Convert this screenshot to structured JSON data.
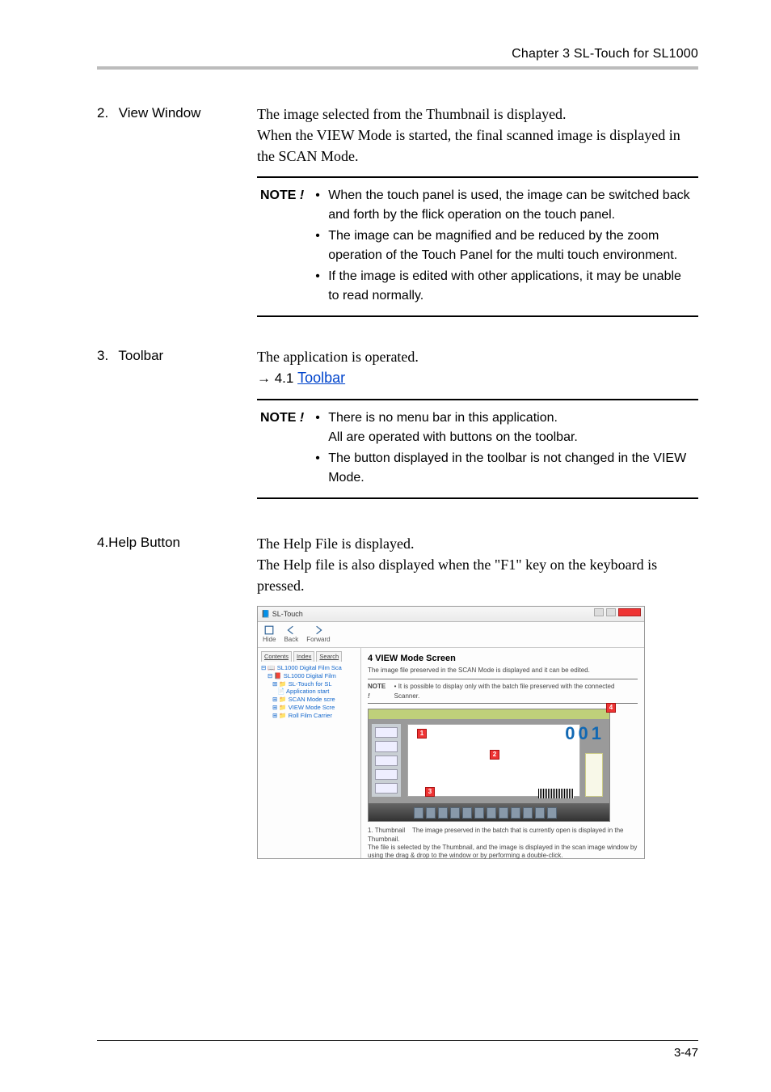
{
  "header": {
    "runhead": "Chapter 3 SL-Touch for SL1000"
  },
  "sections": {
    "s2": {
      "num": "2.",
      "label": "View Window",
      "body": "The image selected from the Thumbnail is displayed.\nWhen the VIEW Mode is started, the final scanned image is displayed in the SCAN Mode.",
      "note_label": "NOTE !",
      "notes": [
        "When the touch panel is used, the image can be switched back and forth by the flick operation on the touch panel.",
        "The image can be magnified and be reduced by the zoom operation of the Touch Panel for the multi touch environment.",
        "If the image is edited with other applications, it may be unable to read normally."
      ]
    },
    "s3": {
      "num": "3.",
      "label": "Toolbar",
      "body": "The application is operated.",
      "link_prefix": "→ 4.1 ",
      "link": "Toolbar",
      "note_label": "NOTE !",
      "notes": [
        "There is no menu bar in this application.\nAll are operated with buttons on the toolbar.",
        "The button displayed in the toolbar is not changed in the VIEW Mode."
      ]
    },
    "s4": {
      "label": "4.Help Button",
      "body": "The Help File is displayed.\nThe Help file is also displayed when the \"F1\" key on the keyboard is pressed."
    }
  },
  "helpwin": {
    "title": "SL-Touch",
    "toolbar": {
      "hide": "Hide",
      "back": "Back",
      "forward": "Forward"
    },
    "tabs": {
      "contents": "Contents",
      "index": "Index",
      "search": "Search"
    },
    "tree": {
      "root": "SL1000 Digital Film Sca",
      "n1": "SL1000 Digital Film",
      "n2": "SL-Touch for SL",
      "n3": "Application start",
      "n4": "SCAN Mode scre",
      "n5": "VIEW Mode Scre",
      "n6": "Roll Film Carrier"
    },
    "content": {
      "h": "4 VIEW Mode Screen",
      "sub": "The image file preserved in the SCAN Mode is displayed and it can be edited.",
      "note_label": "NOTE !",
      "note_text": "It is possible to display only with the batch file preserved with the connected Scanner.",
      "bignum": "001",
      "thumb_label": "1. Thumbnail",
      "thumb_text": "The image preserved in the batch that is currently open is displayed in the Thumbnail.\nThe file is selected by the Thumbnail, and the image is displayed in the scan image window by using the drag & drop to the window or by performing a double-click."
    }
  },
  "footer": {
    "pgnum": "3-47"
  }
}
